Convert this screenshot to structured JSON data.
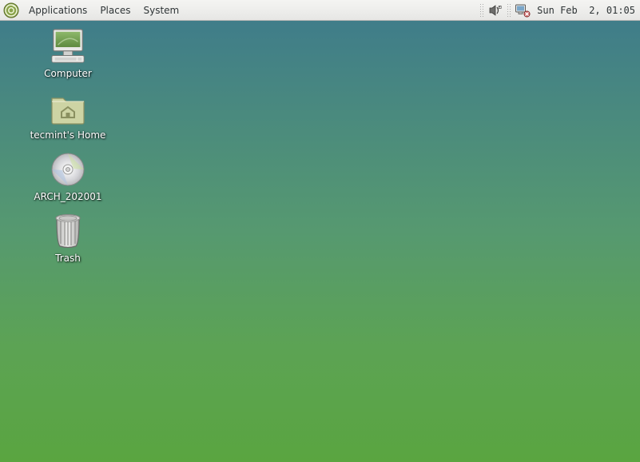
{
  "panel": {
    "menus": [
      "Applications",
      "Places",
      "System"
    ],
    "clock": "Sun Feb  2, 01:05"
  },
  "desktop": {
    "icons": [
      {
        "name": "computer",
        "label": "Computer"
      },
      {
        "name": "home",
        "label": "tecmint's Home"
      },
      {
        "name": "disc",
        "label": "ARCH_202001"
      },
      {
        "name": "trash",
        "label": "Trash"
      }
    ]
  }
}
